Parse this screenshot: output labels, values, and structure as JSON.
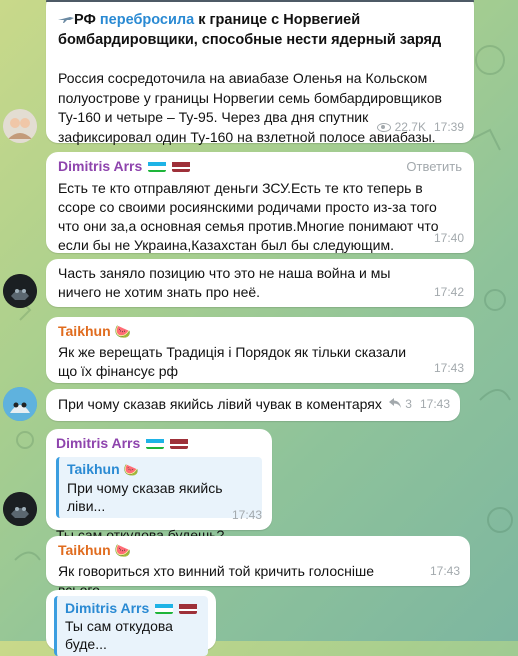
{
  "channel_post": {
    "flag_prefix": "РФ",
    "link_text": "перебросила",
    "title_rest": "к границе с Норвегией бомбардировщики, способные нести ядерный заряд",
    "body": "Россия сосредоточила на авиабазе Оленья на Кольском полуострове у границы Норвегии семь бомбардировщиков Ту-160 и четыре – Ту-95. Через два дня спутник зафиксировал один Ту-160 на взлетной полосе авиабазы.",
    "views": "22.7K",
    "time": "17:39"
  },
  "messages": [
    {
      "sender": "Dimitris Arrs",
      "reply_label": "Ответить",
      "text": "Есть те кто отправляют деньги ЗСУ.Есть те кто теперь в ссоре со своими росиянскими родичами просто из-за того что они за,а основная семья против.Многие понимают что если бы не Украина,Казахстан был бы следующим.",
      "time": "17:40"
    },
    {
      "text": "Часть заняло позицию что это не наша война и мы ничего не хотим знать про неё.",
      "time": "17:42"
    },
    {
      "sender": "Taikhun",
      "text": "Як же верещать Традиція і Порядок як тільки сказали що їх фінансує рф",
      "time": "17:43"
    },
    {
      "text": "При чому сказав якийсь лівий чувак в коментарях",
      "replies_count": "3",
      "time": "17:43"
    },
    {
      "sender": "Dimitris Arrs",
      "quote_sender": "Taikhun",
      "quote_text": "При чому сказав якийсь ліви...",
      "text": "Ты сам откудова будешь?",
      "time": "17:43"
    },
    {
      "sender": "Taikhun",
      "text": "Як говориться хто винний той кричить голосніше всього",
      "time": "17:43"
    },
    {
      "quote_sender": "Dimitris Arrs",
      "quote_text": "Ты сам откудова буде..."
    }
  ],
  "colors": {
    "dimitris_name": "#8e44ad",
    "taikhun_name": "#e06c1f",
    "link": "#2a8ad3",
    "meta": "#a3a9ad"
  },
  "icons": {
    "reply_arrow": "reply-arrow-icon",
    "views": "eye-icon",
    "watermelon": "watermelon-icon",
    "flags": [
      "uzbekistan-flag-icon",
      "latvia-flag-icon"
    ]
  }
}
